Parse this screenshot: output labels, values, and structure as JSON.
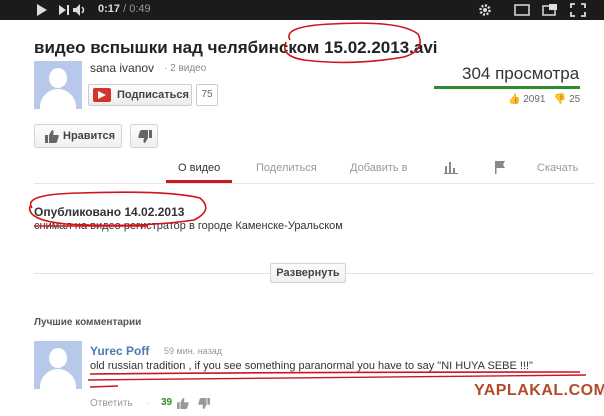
{
  "player": {
    "current_time": "0:17",
    "separator": " / ",
    "total_time": "0:49",
    "progress_fraction": 0.35
  },
  "video": {
    "title": "видео вспышки над челябинском 15.02.2013.avi"
  },
  "channel": {
    "name": "sana ivanov",
    "videos_label": "· 2 видео",
    "subscribe_label": "Подписаться",
    "subscriber_count": "75"
  },
  "stats": {
    "views": "304 просмотра",
    "likes": "2091",
    "dislikes": "25"
  },
  "actions": {
    "like_label": "Нравится"
  },
  "tabs": [
    {
      "label": "О видео",
      "active": true
    },
    {
      "label": "Поделиться",
      "active": false
    },
    {
      "label": "Добавить в",
      "active": false
    },
    {
      "label": "Скачать",
      "active": false
    }
  ],
  "about": {
    "published": "Опубликовано 14.02.2013",
    "description": "снимал на видео регистратор в городе Каменске-Уральском",
    "expand_label": "Развернуть"
  },
  "comments": {
    "heading": "Лучшие комментарии",
    "items": [
      {
        "author": "Yurec Poff",
        "time": "59 мин. назад",
        "text": "old russian tradition , if you see something paranormal you have to say \"NI HUYA SEBE !!!\"",
        "reply_label": "Ответить",
        "dot": "·",
        "likes": "39"
      }
    ]
  },
  "watermark": "YAPLAKAL.COM",
  "colors": {
    "player_bar": "#1b1b1b",
    "active_tab_underline": "#cc181e",
    "views_bar": "#2e8b2e",
    "annotation_red": "#d0141c",
    "author_link": "#4a7ab8",
    "watermark": "#b34b28"
  },
  "icons": [
    "play-icon",
    "skip-icon",
    "volume-icon",
    "settings-icon",
    "window-icon",
    "popout-icon",
    "fullscreen-icon",
    "youtube-logo-icon",
    "thumbs-up-icon",
    "thumbs-down-icon",
    "stats-icon",
    "flag-icon",
    "avatar-placeholder-icon"
  ]
}
